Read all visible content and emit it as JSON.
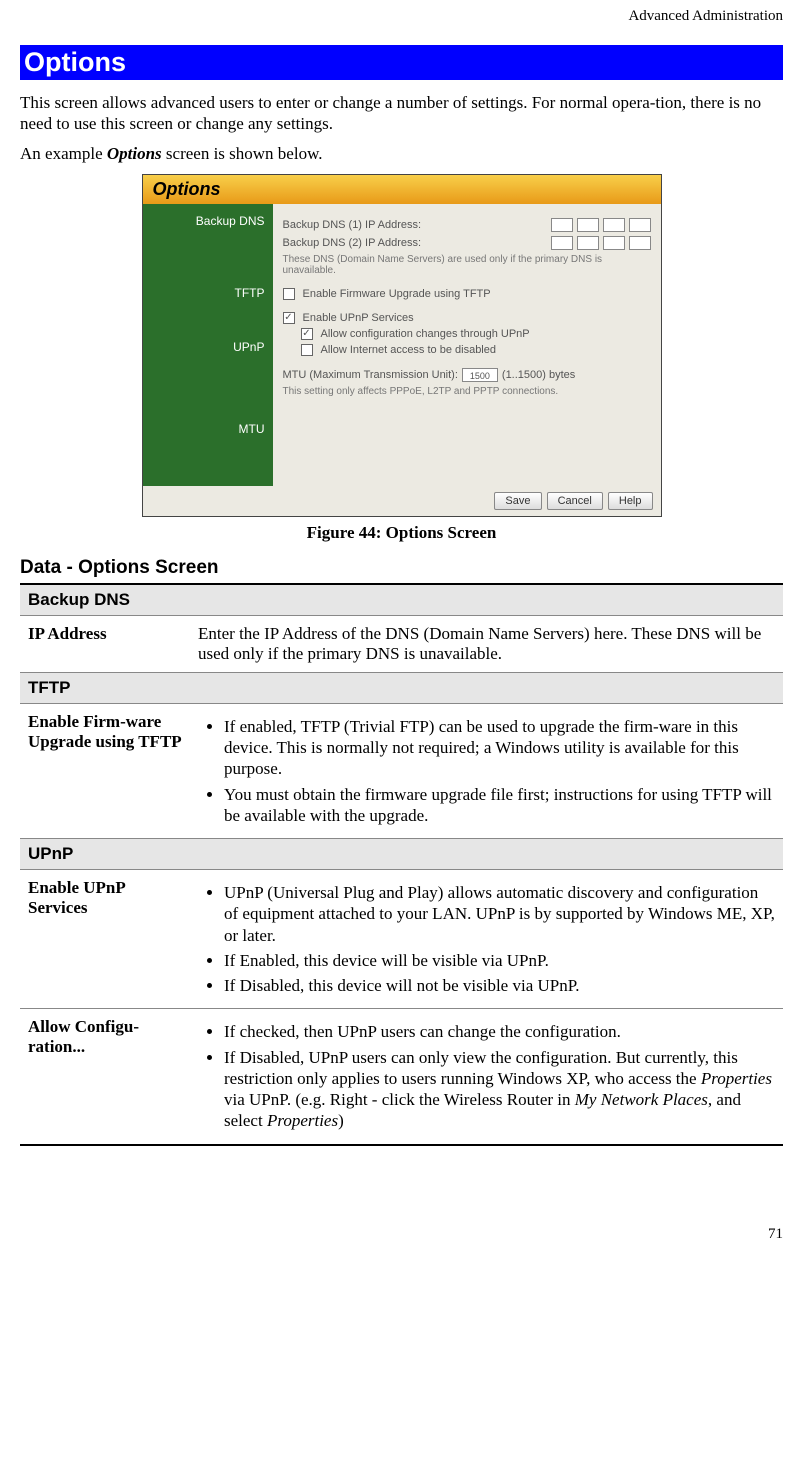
{
  "header": {
    "chapter": "Advanced Administration"
  },
  "headings": {
    "h1": "Options",
    "h2": "Data - Options Screen",
    "fig_caption": "Figure 44: Options Screen"
  },
  "intro": {
    "p1": "This screen allows advanced users to enter or change a number of settings. For normal opera-tion, there is no need to use this screen or change any settings.",
    "p2_pre": "An example ",
    "p2_em": "Options",
    "p2_post": " screen is shown below."
  },
  "screenshot": {
    "title": "Options",
    "side": {
      "backup": "Backup DNS",
      "tftp": "TFTP",
      "upnp": "UPnP",
      "mtu": "MTU"
    },
    "dns1_label": "Backup DNS (1) IP Address:",
    "dns2_label": "Backup DNS (2) IP Address:",
    "dns_note": "These DNS (Domain Name Servers) are used only if the primary DNS is unavailable.",
    "tftp_cb": "Enable Firmware Upgrade using TFTP",
    "upnp_cb": "Enable UPnP Services",
    "upnp_allow_config": "Allow configuration changes through UPnP",
    "upnp_allow_disable": "Allow Internet access to be disabled",
    "mtu_label_pre": "MTU (Maximum Transmission Unit):",
    "mtu_value": "1500",
    "mtu_label_post": "(1..1500) bytes",
    "mtu_note": "This setting only affects PPPoE, L2TP and PPTP connections.",
    "btn_save": "Save",
    "btn_cancel": "Cancel",
    "btn_help": "Help"
  },
  "table": {
    "sec_backup": "Backup DNS",
    "ip_label": "IP Address",
    "ip_desc": "Enter the IP Address of the DNS (Domain Name Servers) here. These DNS will be used only if the primary DNS is unavailable.",
    "sec_tftp": "TFTP",
    "tftp_label": "Enable Firm-ware Upgrade using TFTP",
    "tftp_b1": "If enabled, TFTP (Trivial FTP) can be used to upgrade the firm-ware in this device. This is normally not required; a Windows utility is available for this purpose.",
    "tftp_b2": "You must obtain the firmware upgrade file first; instructions for using TFTP will be available with the upgrade.",
    "sec_upnp": "UPnP",
    "upnp1_label": "Enable UPnP Services",
    "upnp1_b1": "UPnP (Universal Plug and Play) allows automatic discovery and configuration of equipment attached to your LAN. UPnP is by supported by Windows ME, XP, or later.",
    "upnp1_b2": "If Enabled, this device will be visible via UPnP.",
    "upnp1_b3": "If Disabled, this device will not be visible via UPnP.",
    "upnp2_label": "Allow Configu-ration...",
    "upnp2_b1": "If checked, then UPnP users can change the configuration.",
    "upnp2_b2_pre": "If Disabled, UPnP users can only view the configuration. But currently, this restriction only applies to users running Windows XP, who access the ",
    "upnp2_b2_em1": "Properties",
    "upnp2_b2_mid": " via UPnP. (e.g. Right - click the Wireless Router in ",
    "upnp2_b2_em2": "My Network Places",
    "upnp2_b2_mid2": ", and select ",
    "upnp2_b2_em3": "Properties",
    "upnp2_b2_post": ")"
  },
  "page_number": "71"
}
